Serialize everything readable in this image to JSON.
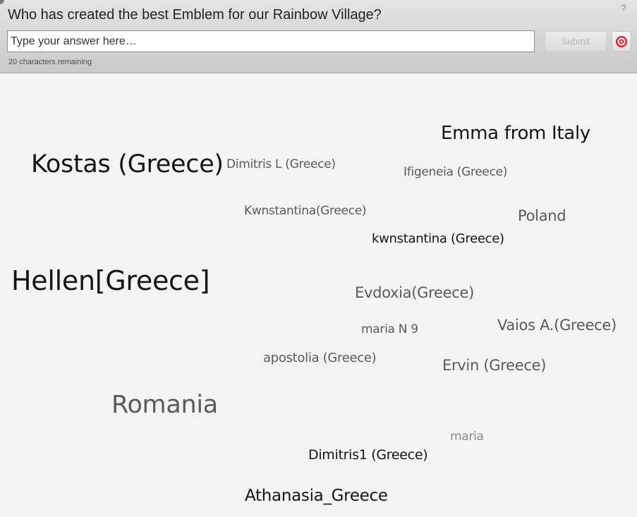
{
  "header": {
    "question": "Who has created the best Emblem for our Rainbow Village?",
    "help_label": "?",
    "answer_placeholder": "Type your answer here…",
    "submit_label": "Submit",
    "chars_remaining": "20 characters remaining",
    "target_icon": "target-icon"
  },
  "colors": {
    "header_bg": "#d6d6d6",
    "cloud_bg": "#f3f3f3",
    "target_red": "#e8202a"
  },
  "word_cloud": [
    {
      "id": "emma-from-italy",
      "text": "Emma from Italy"
    },
    {
      "id": "kostas-greece",
      "text": "Kostas (Greece)"
    },
    {
      "id": "dimitris-l-greece",
      "text": "Dimitris L (Greece)"
    },
    {
      "id": "ifigeneia-greece",
      "text": "Ifigeneia (Greece)"
    },
    {
      "id": "kwnstantina-greece-1",
      "text": "Kwnstantina(Greece)"
    },
    {
      "id": "poland",
      "text": "Poland"
    },
    {
      "id": "kwnstantina-greece-2",
      "text": "kwnstantina (Greece)"
    },
    {
      "id": "hellen-greece",
      "text": "Hellen[Greece]"
    },
    {
      "id": "evdoxia-greece",
      "text": "Evdoxia(Greece)"
    },
    {
      "id": "maria-n-9",
      "text": "maria N 9"
    },
    {
      "id": "vaios-a-greece",
      "text": "Vaios A.(Greece)"
    },
    {
      "id": "apostolia-greece",
      "text": "apostolia (Greece)"
    },
    {
      "id": "ervin-greece",
      "text": "Ervin (Greece)"
    },
    {
      "id": "romania",
      "text": "Romania"
    },
    {
      "id": "maria",
      "text": "maria"
    },
    {
      "id": "dimitris1-greece",
      "text": "Dimitris1 (Greece)"
    },
    {
      "id": "athanasia-greece",
      "text": "Athanasia_Greece"
    }
  ]
}
